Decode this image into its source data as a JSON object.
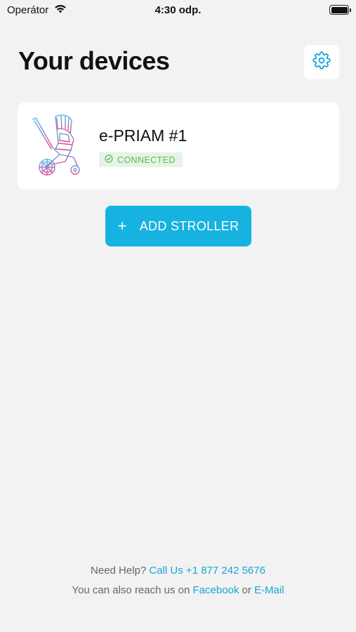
{
  "status_bar": {
    "carrier": "Operátor",
    "time": "4:30 odp."
  },
  "header": {
    "title": "Your devices",
    "settings_icon": "gear-icon"
  },
  "devices": [
    {
      "name": "e-PRIAM #1",
      "status": "CONNECTED",
      "status_icon": "check-circle-icon",
      "image_icon": "stroller-icon"
    }
  ],
  "actions": {
    "add_stroller_label": "ADD STROLLER",
    "add_icon": "plus-icon"
  },
  "footer": {
    "help_text": "Need Help?",
    "call_link": "Call Us +1 877 242 5676",
    "reach_text": "You can also reach us on",
    "facebook_link": "Facebook",
    "or_text": "or",
    "email_link": "E-Mail"
  },
  "colors": {
    "accent": "#16b2e0",
    "link": "#16a6d8",
    "status_green": "#5cb85c",
    "status_green_bg": "#e6f4e6",
    "background": "#f2f2f2"
  }
}
